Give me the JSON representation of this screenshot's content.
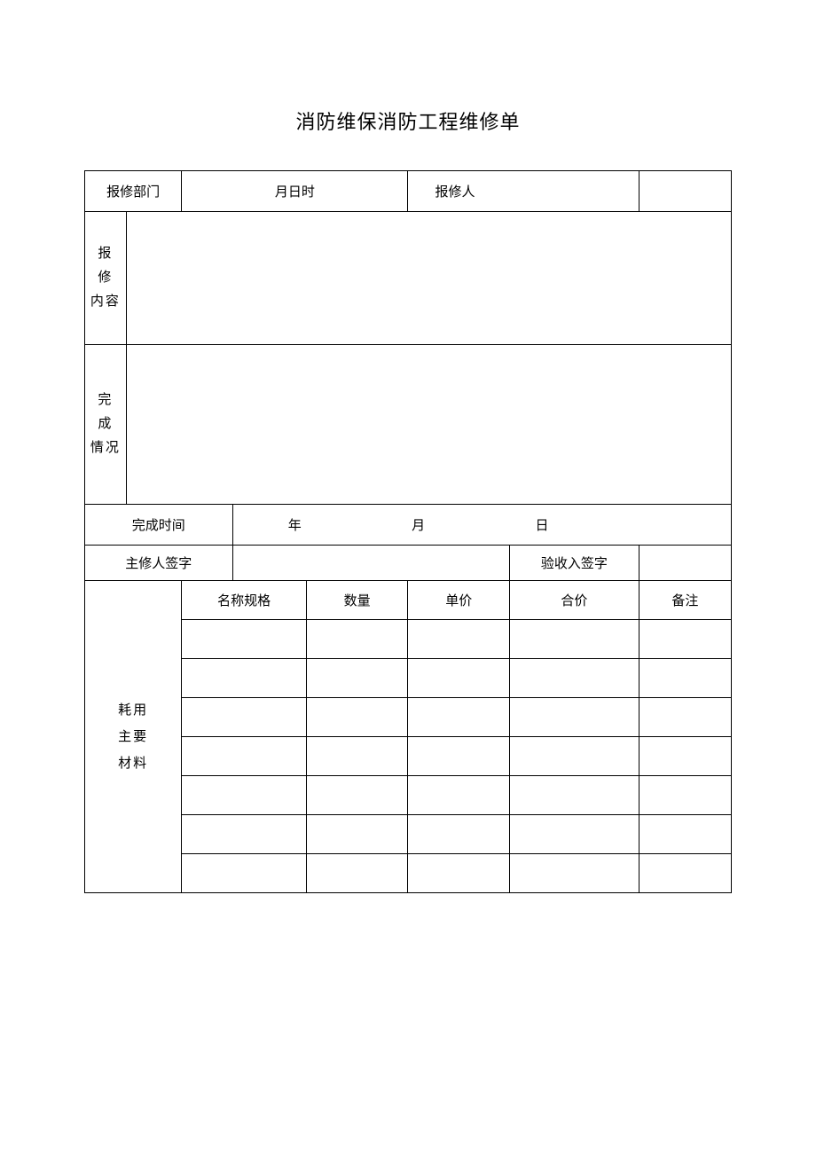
{
  "title": "消防维保消防工程维修单",
  "row1": {
    "dept_label": "报修部门",
    "dept_value": "",
    "date_label": "月日时",
    "reporter_label": "报修人",
    "reporter_value": ""
  },
  "content": {
    "label_line1": "报 修",
    "label_line2": "内容",
    "value": ""
  },
  "completion": {
    "label_line1": "完 成",
    "label_line2": "情况",
    "value": ""
  },
  "complete_time": {
    "label": "完成时间",
    "year": "年",
    "month": "月",
    "day": "日"
  },
  "signatures": {
    "repairer_label": "主修人签字",
    "repairer_value": "",
    "inspector_label": "验收入签字",
    "inspector_value": ""
  },
  "materials": {
    "side_label_line1": "耗用",
    "side_label_line2": "主要",
    "side_label_line3": "材料",
    "headers": {
      "spec": "名称规格",
      "qty": "数量",
      "unit_price": "单价",
      "total_price": "合价",
      "remark": "备注"
    },
    "rows": [
      {
        "spec": "",
        "qty": "",
        "unit_price": "",
        "total_price": "",
        "remark": ""
      },
      {
        "spec": "",
        "qty": "",
        "unit_price": "",
        "total_price": "",
        "remark": ""
      },
      {
        "spec": "",
        "qty": "",
        "unit_price": "",
        "total_price": "",
        "remark": ""
      },
      {
        "spec": "",
        "qty": "",
        "unit_price": "",
        "total_price": "",
        "remark": ""
      },
      {
        "spec": "",
        "qty": "",
        "unit_price": "",
        "total_price": "",
        "remark": ""
      },
      {
        "spec": "",
        "qty": "",
        "unit_price": "",
        "total_price": "",
        "remark": ""
      },
      {
        "spec": "",
        "qty": "",
        "unit_price": "",
        "total_price": "",
        "remark": ""
      }
    ]
  }
}
